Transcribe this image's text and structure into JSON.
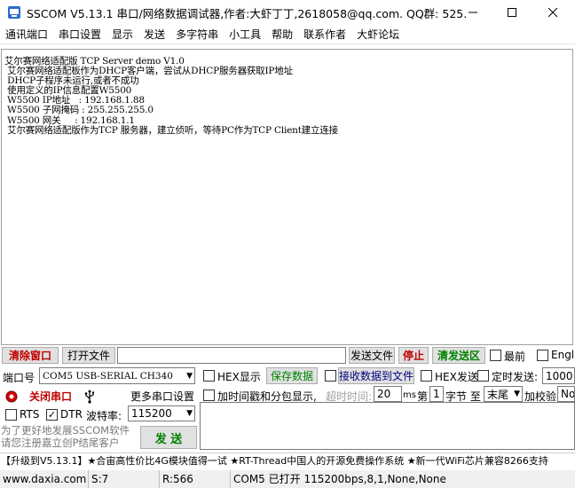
{
  "window": {
    "title": "SSCOM V5.13.1 串口/网络数据调试器,作者:大虾丁丁,2618058@qq.com. QQ群: 525..."
  },
  "menu": {
    "items": [
      "通讯端口",
      "串口设置",
      "显示",
      "发送",
      "多字符串",
      "小工具",
      "帮助",
      "联系作者",
      "大虾论坛"
    ]
  },
  "receive": {
    "lines": [
      "艾尔赛网络适配版 TCP Server demo V1.0",
      " 艾尔赛网络适配板作为DHCP客户端，尝试从DHCP服务器获取IP地址",
      " DHCP子程序未运行,或者不成功",
      " 使用定义的IP信息配置W5500",
      " W5500 IP地址   : 192.168.1.88",
      " W5500 子网掩码 : 255.255.255.0",
      " W5500 网关     : 192.168.1.1",
      " 艾尔赛网络适配版作为TCP 服务器，建立侦听，等待PC作为TCP Client建立连接"
    ]
  },
  "toolbar": {
    "clear_window": "清除窗口",
    "open_file": "打开文件",
    "send_file": "发送文件",
    "stop": "停止",
    "clear_send": "清发送区",
    "latest": "最前",
    "english": "English"
  },
  "port": {
    "label": "端口号",
    "value": "COM5 USB-SERIAL CH340",
    "close_port": "关闭串口",
    "more_settings": "更多串口设置",
    "rts": "RTS",
    "dtr": "DTR",
    "baud_label": "波特率:",
    "baud_value": "115200"
  },
  "display": {
    "hex_display": "HEX显示",
    "save_data": "保存数据",
    "recv_to_file": "接收数据到文件",
    "hex_send": "HEX发送",
    "timed_send": "定时发送:",
    "timed_value": "1000",
    "timestamp": "加时间戳和分包显示,",
    "timeout_label": "超时时间:",
    "timeout_value": "20",
    "ms": "ms",
    "nth_label": "第",
    "nth_value": "1",
    "byte_label": "字节 至",
    "end_value": "末尾",
    "checksum_label": "加校验",
    "checksum_value": "No"
  },
  "send": {
    "hint": "为了更好地发展SSCOM软件\n请您注册嘉立创P结尾客户",
    "send_button": "发 送"
  },
  "banner": "【升级到V5.13.1】★合宙高性价比4G模块值得一试 ★RT-Thread中国人的开源免费操作系统 ★新一代WiFi芯片兼容8266支持",
  "status": {
    "website": "www.daxia.com",
    "sent": "S:7",
    "received": "R:566",
    "port_status": "COM5 已打开  115200bps,8,1,None,None"
  },
  "colors": {
    "accent_red": "#c00000",
    "accent_green": "#008000",
    "port_led": "#d00000"
  }
}
